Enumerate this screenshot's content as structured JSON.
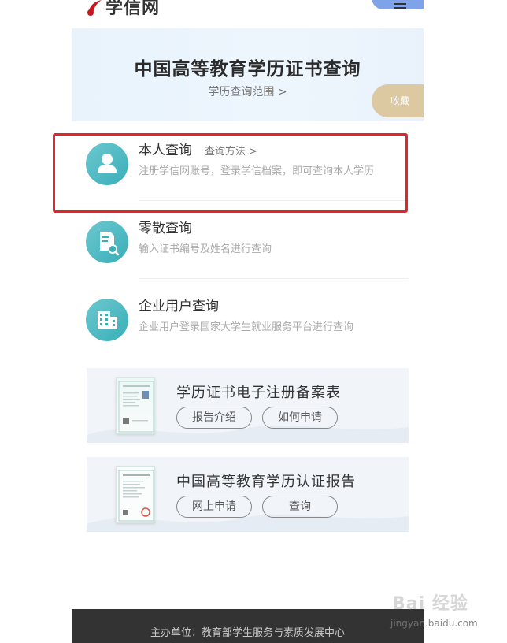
{
  "header": {
    "logo_text": "学信网",
    "logo_icon": "xuexin-logo-icon",
    "menu_icon": "hamburger-menu-icon"
  },
  "banner": {
    "title": "中国高等教育学历证书查询",
    "subtitle": "学历查询范围 >",
    "favorite_label": "收藏"
  },
  "queries": [
    {
      "title": "本人查询",
      "method": "查询方法 >",
      "desc": "注册学信网账号，登录学信档案，即可查询本人学历",
      "icon": "person-icon"
    },
    {
      "title": "零散查询",
      "method": "",
      "desc": "输入证书编号及姓名进行查询",
      "icon": "document-search-icon"
    },
    {
      "title": "企业用户查询",
      "method": "",
      "desc": "企业用户登录国家大学生就业服务平台进行查询",
      "icon": "building-icon"
    }
  ],
  "cards": [
    {
      "title": "学历证书电子注册备案表",
      "buttons": [
        "报告介绍",
        "如何申请"
      ]
    },
    {
      "title": "中国高等教育学历认证报告",
      "buttons": [
        "网上申请",
        "查询"
      ]
    }
  ],
  "footer": {
    "text": "主办单位：教育部学生服务与素质发展中心"
  },
  "watermark": {
    "main": "Bai 经验",
    "sub": "jingyan.baidu.com"
  },
  "colors": {
    "accent_teal": "#3aaeb8",
    "highlight_red": "#e0262a",
    "favorite_gold": "#dcc9a1",
    "menu_blue": "#7fa3e8",
    "footer_bg": "#333333"
  }
}
